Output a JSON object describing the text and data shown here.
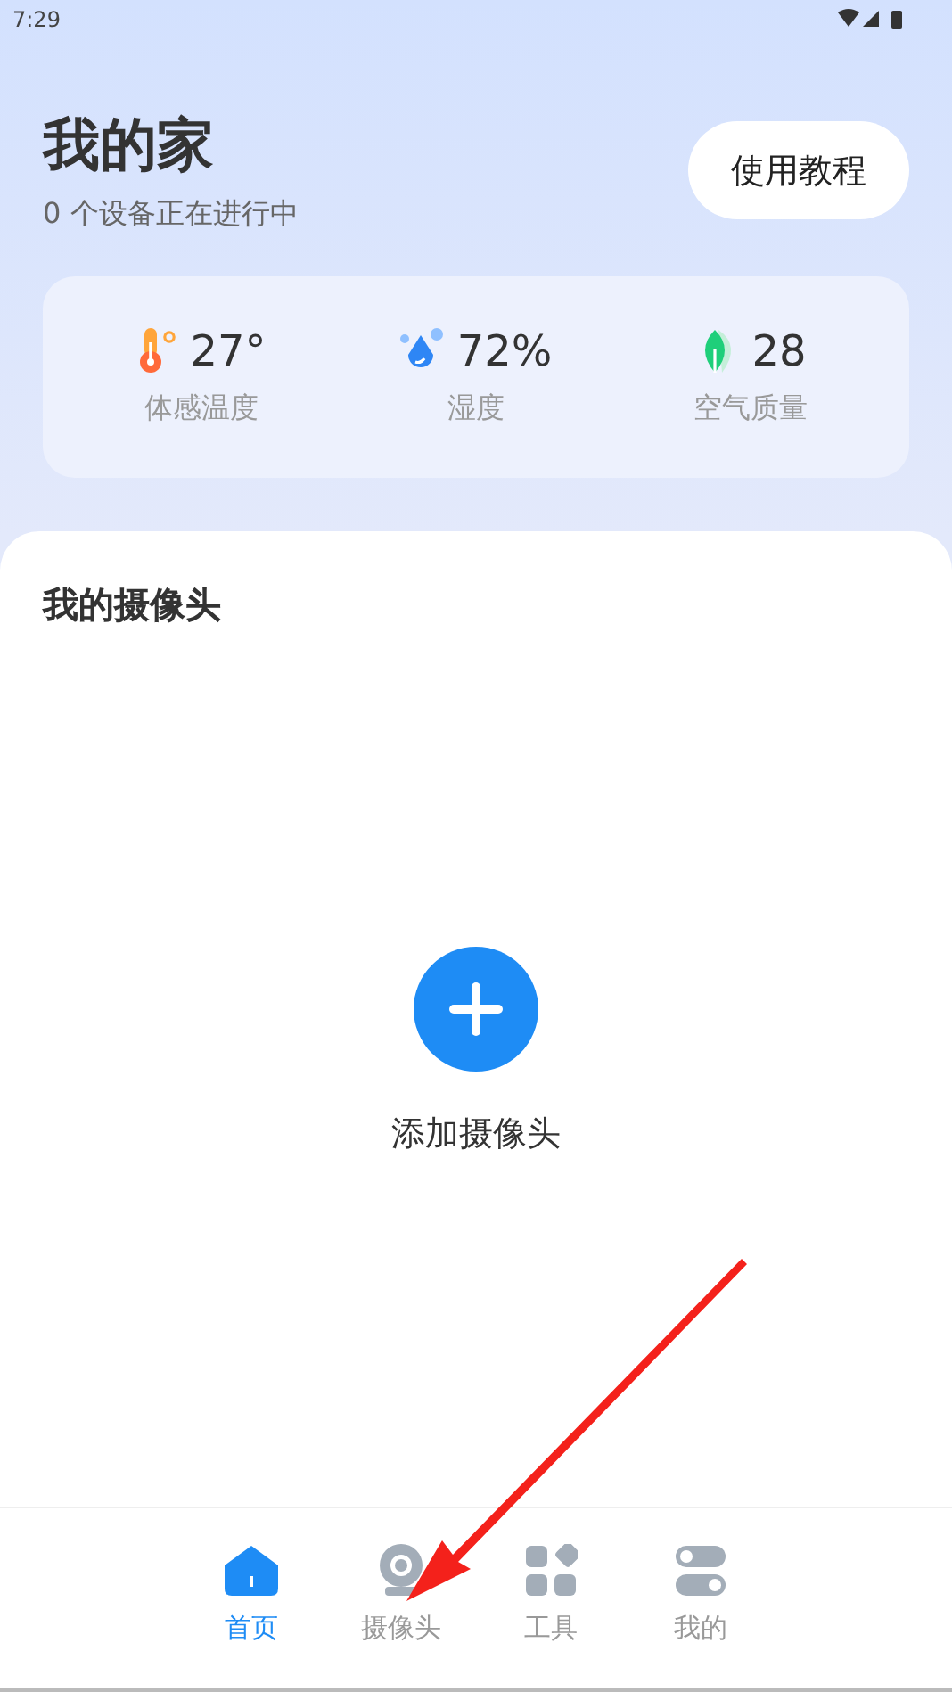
{
  "status_bar": {
    "time": "7:29"
  },
  "header": {
    "title": "我的家",
    "subtitle": "0 个设备正在进行中",
    "button": "使用教程"
  },
  "weather": [
    {
      "kind": "temperature",
      "value": "27°",
      "label": "体感温度"
    },
    {
      "kind": "humidity",
      "value": "72%",
      "label": "湿度"
    },
    {
      "kind": "air",
      "value": "28",
      "label": "空气质量"
    }
  ],
  "cameras": {
    "title": "我的摄像头",
    "add_label": "添加摄像头"
  },
  "nav": [
    {
      "kind": "home",
      "label": "首页",
      "selected": true
    },
    {
      "kind": "camera",
      "label": "摄像头",
      "selected": false
    },
    {
      "kind": "tools",
      "label": "工具",
      "selected": false
    },
    {
      "kind": "profile",
      "label": "我的",
      "selected": false
    }
  ]
}
